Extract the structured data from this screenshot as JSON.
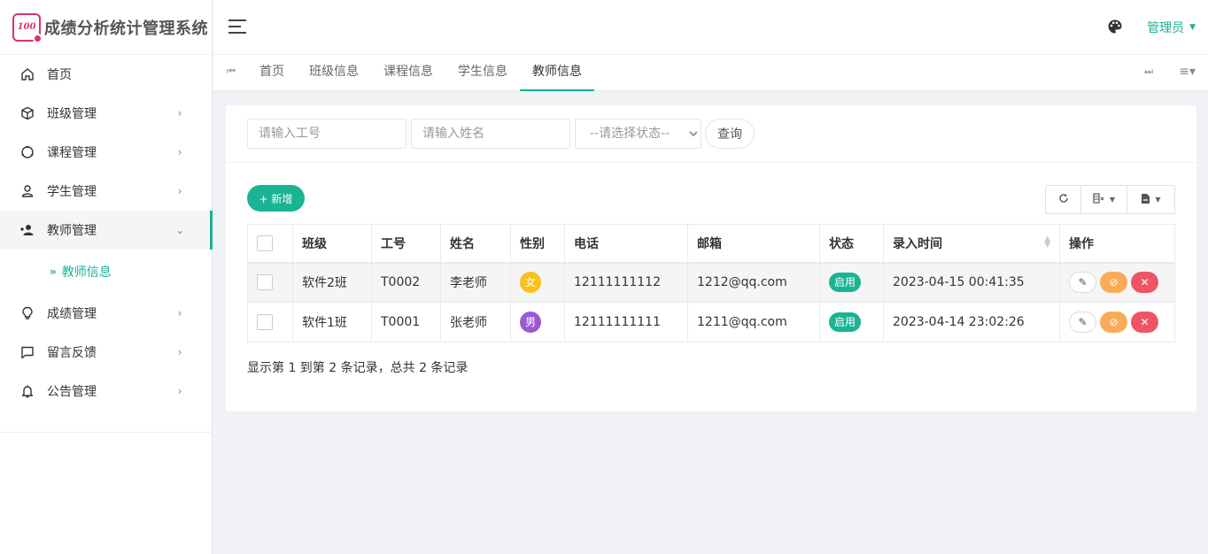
{
  "app": {
    "title": "成绩分析统计管理系统",
    "logo_text": "100"
  },
  "header": {
    "user": "管理员"
  },
  "sidebar": {
    "items": [
      {
        "label": "首页",
        "icon": "home-icon",
        "has_arrow": false
      },
      {
        "label": "班级管理",
        "icon": "cube-icon",
        "has_arrow": true
      },
      {
        "label": "课程管理",
        "icon": "circle-icon",
        "has_arrow": true
      },
      {
        "label": "学生管理",
        "icon": "user-icon",
        "has_arrow": true
      },
      {
        "label": "教师管理",
        "icon": "user-add-icon",
        "has_arrow": true,
        "open": true
      },
      {
        "label": "成绩管理",
        "icon": "bulb-icon",
        "has_arrow": true
      },
      {
        "label": "留言反馈",
        "icon": "message-icon",
        "has_arrow": true
      },
      {
        "label": "公告管理",
        "icon": "bell-icon",
        "has_arrow": true
      }
    ],
    "submenu": {
      "label": "教师信息"
    }
  },
  "tabs": [
    "首页",
    "班级信息",
    "课程信息",
    "学生信息",
    "教师信息"
  ],
  "active_tab": "教师信息",
  "search": {
    "no_placeholder": "请输入工号",
    "name_placeholder": "请输入姓名",
    "status_option": "--请选择状态--",
    "query_label": "查询"
  },
  "toolbar": {
    "add_label": "+ 新增"
  },
  "table": {
    "headers": [
      "班级",
      "工号",
      "姓名",
      "性别",
      "电话",
      "邮箱",
      "状态",
      "录入时间",
      "操作"
    ],
    "rows": [
      {
        "class": "软件2班",
        "no": "T0002",
        "name": "李老师",
        "gender": "女",
        "phone": "12111111112",
        "email": "1212@qq.com",
        "status": "启用",
        "time": "2023-04-15 00:41:35"
      },
      {
        "class": "软件1班",
        "no": "T0001",
        "name": "张老师",
        "gender": "男",
        "phone": "12111111111",
        "email": "1211@qq.com",
        "status": "启用",
        "time": "2023-04-14 23:02:26"
      }
    ]
  },
  "pagination": {
    "summary": "显示第 1 到第 2 条记录，总共 2 条记录"
  },
  "colors": {
    "accent": "#1ab394",
    "female": "#f8c11c",
    "male": "#9b59d0",
    "warning": "#f8ac59",
    "danger": "#ed5565",
    "logo": "#d9346b"
  }
}
